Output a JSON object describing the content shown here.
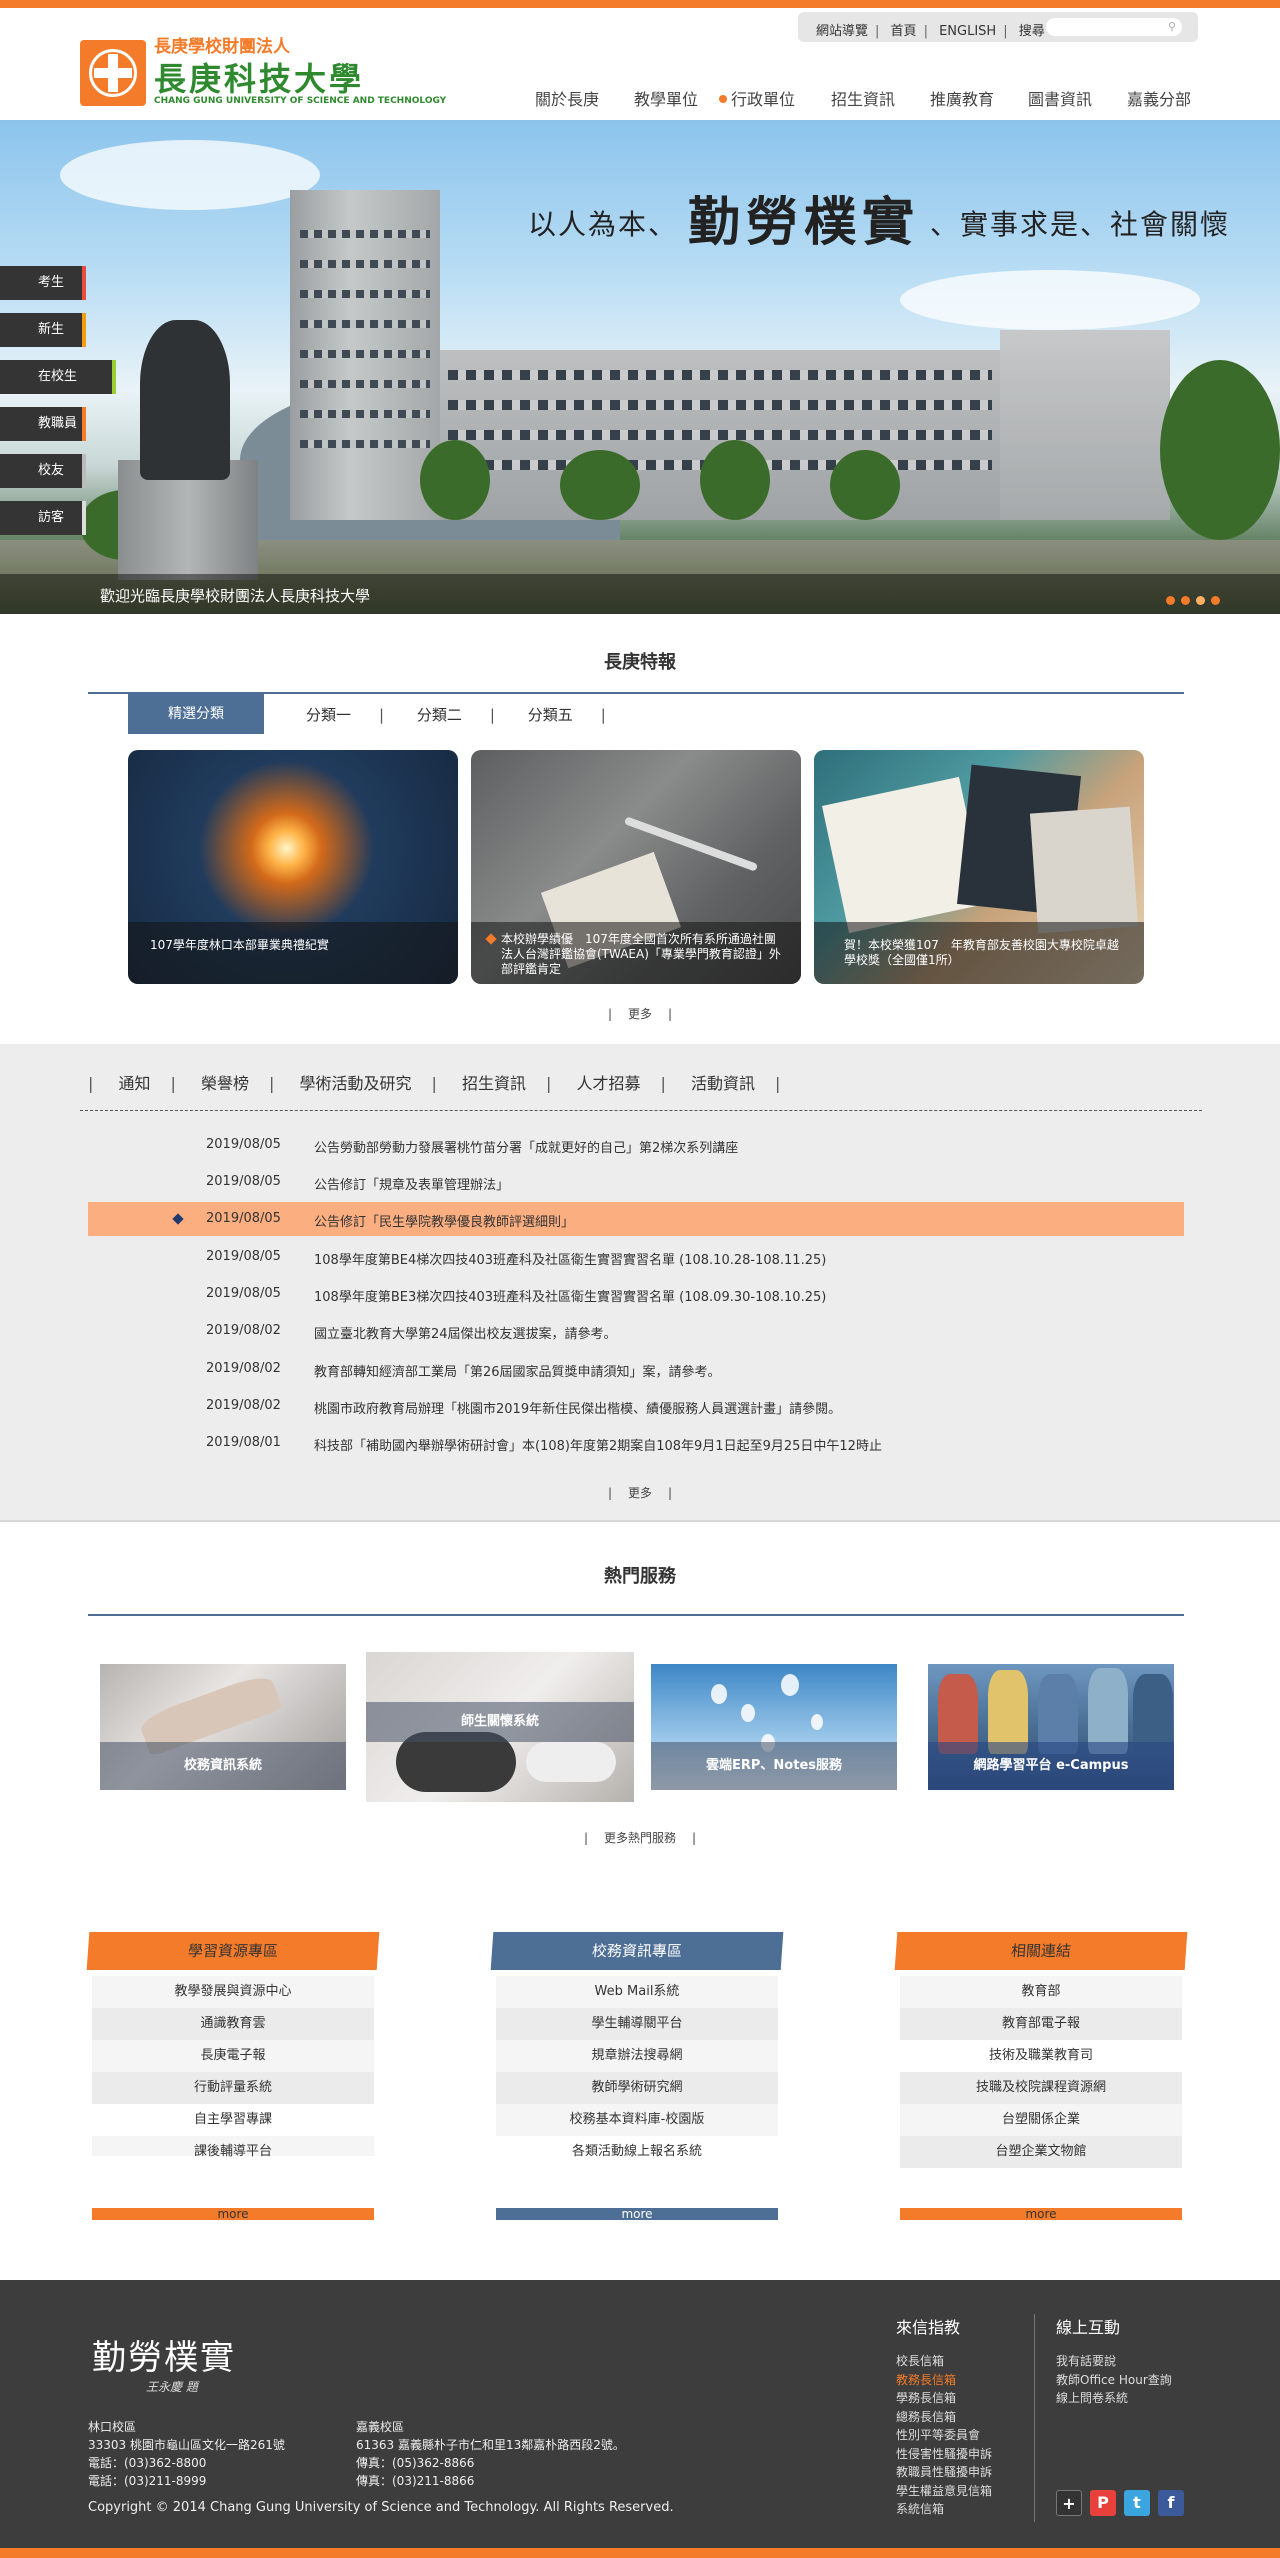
{
  "header": {
    "logo_sub": "長庚學校財團法人",
    "logo_main": "長庚科技大學",
    "logo_en": "CHANG GUNG UNIVERSITY OF SCIENCE AND TECHNOLOGY",
    "util_links": [
      "網站導覽",
      "首頁",
      "ENGLISH",
      "搜尋"
    ],
    "search_placeholder": "",
    "nav": [
      "關於長庚",
      "教學單位",
      "行政單位",
      "招生資訊",
      "推廣教育",
      "圖書資訊",
      "嘉義分部"
    ],
    "nav_active_index": 2
  },
  "hero": {
    "slogan_pre": "以人為本、",
    "slogan_big": "勤勞樸實",
    "slogan_post": "、實事求是、社會關懷",
    "caption": "歡迎光臨長庚學校財團法人長庚科技大學",
    "slide_count": 4,
    "active_slide": 3
  },
  "side_menu": [
    "考生",
    "新生",
    "在校生",
    "教職員",
    "校友",
    "訪客"
  ],
  "highlights": {
    "title": "長庚特報",
    "active_tab": "精選分類",
    "tabs": [
      "分類一",
      "分類二",
      "分類五"
    ],
    "cards": [
      {
        "caption": "107學年度林口本部畢業典禮紀實"
      },
      {
        "caption": "本校辦學績優　107年度全國首次所有系所通過社團法人台灣評鑑協會(TWAEA)「專業學門教育認證」外部評鑑肯定"
      },
      {
        "caption": "賀！本校榮獲107　年教育部友善校園大專校院卓越學校獎（全國僅1所）"
      }
    ],
    "more": "更多"
  },
  "news": {
    "tabs": [
      "通知",
      "榮譽榜",
      "學術活動及研究",
      "招生資訊",
      "人才招募",
      "活動資訊"
    ],
    "rows": [
      {
        "date": "2019/08/05",
        "title": "公告勞動部勞動力發展署桃竹苗分署「成就更好的自己」第2梯次系列講座"
      },
      {
        "date": "2019/08/05",
        "title": "公告修訂「規章及表單管理辦法」"
      },
      {
        "date": "2019/08/05",
        "title": "公告修訂「民生學院教學優良教師評選細則」"
      },
      {
        "date": "2019/08/05",
        "title": "108學年度第BE4梯次四技403班產科及社區衛生實習實習名單 (108.10.28-108.11.25)"
      },
      {
        "date": "2019/08/05",
        "title": "108學年度第BE3梯次四技403班產科及社區衛生實習實習名單 (108.09.30-108.10.25)"
      },
      {
        "date": "2019/08/02",
        "title": "國立臺北教育大學第24屆傑出校友選拔案，請參考。"
      },
      {
        "date": "2019/08/02",
        "title": "教育部轉知經濟部工業局「第26屆國家品質獎申請須知」案，請參考。"
      },
      {
        "date": "2019/08/02",
        "title": "桃園市政府教育局辦理「桃園市2019年新住民傑出楷模、績優服務人員選選計畫」請參閱。"
      },
      {
        "date": "2019/08/01",
        "title": "科技部「補助國內舉辦學術研討會」本(108)年度第2期案自108年9月1日起至9月25日中午12時止"
      }
    ],
    "highlight_index": 2,
    "more": "更多"
  },
  "services": {
    "title": "熱門服務",
    "items": [
      "校務資訊系統",
      "師生關懷系統",
      "雲端ERP、Notes服務",
      "網路學習平台 e-Campus"
    ],
    "more": "更多熱門服務"
  },
  "boxes": [
    {
      "title": "學習資源專區",
      "items": [
        "教學發展與資源中心",
        "通識教育雲",
        "長庚電子報",
        "行動評量系統",
        "自主學習專課",
        "課後輔導平台"
      ],
      "more": "more"
    },
    {
      "title": "校務資訊專區",
      "items": [
        "Web Mail系統",
        "學生輔導關平台",
        "規章辦法搜尋網",
        "教師學術研究網",
        "校務基本資料庫-校園版",
        "各類活動線上報名系統"
      ],
      "more": "more"
    },
    {
      "title": "相關連結",
      "items": [
        "教育部",
        "教育部電子報",
        "技術及職業教育司",
        "技職及校院課程資源網",
        "台塑關係企業",
        "台塑企業文物館"
      ],
      "more": "more"
    }
  ],
  "footer": {
    "calligraphy": "勤勞樸實",
    "signature": "王永慶 題",
    "campus1": {
      "name": "林口校區",
      "address": "33303 桃園市龜山區文化一路261號",
      "phone": "電話：(03)362-8800",
      "fax": "電話：(03)211-8999"
    },
    "campus2": {
      "name": "嘉義校區",
      "address": "61363 嘉義縣朴子市仁和里13鄰嘉朴路西段2號。",
      "phone": "傳真：(05)362-8866",
      "fax": "傳真：(03)211-8866"
    },
    "copyright": "Copyright © 2014 Chang Gung University of Science and Technology. All Rights Reserved.",
    "mail_title": "來信指教",
    "mail_items": [
      "校長信箱",
      "教務長信箱",
      "學務長信箱",
      "總務長信箱",
      "性別平等委員會",
      "性侵害性騷擾申訴",
      "教職員性騷擾申訴",
      "學生權益意見信箱",
      "系統信箱"
    ],
    "mail_highlight_index": 1,
    "online_title": "線上互動",
    "online_items": [
      "我有話要說",
      "教師Office Hour查詢",
      "線上問卷系統"
    ],
    "social": [
      "plus-icon",
      "plurk-icon",
      "twitter-icon",
      "facebook-icon"
    ],
    "social_colors": [
      "#333333",
      "#e8413b",
      "#3aa5de",
      "#3b5a9a"
    ]
  },
  "colors": {
    "accent": "#f47b29",
    "blue": "#4d6f96",
    "news_highlight": "#fbae80"
  }
}
